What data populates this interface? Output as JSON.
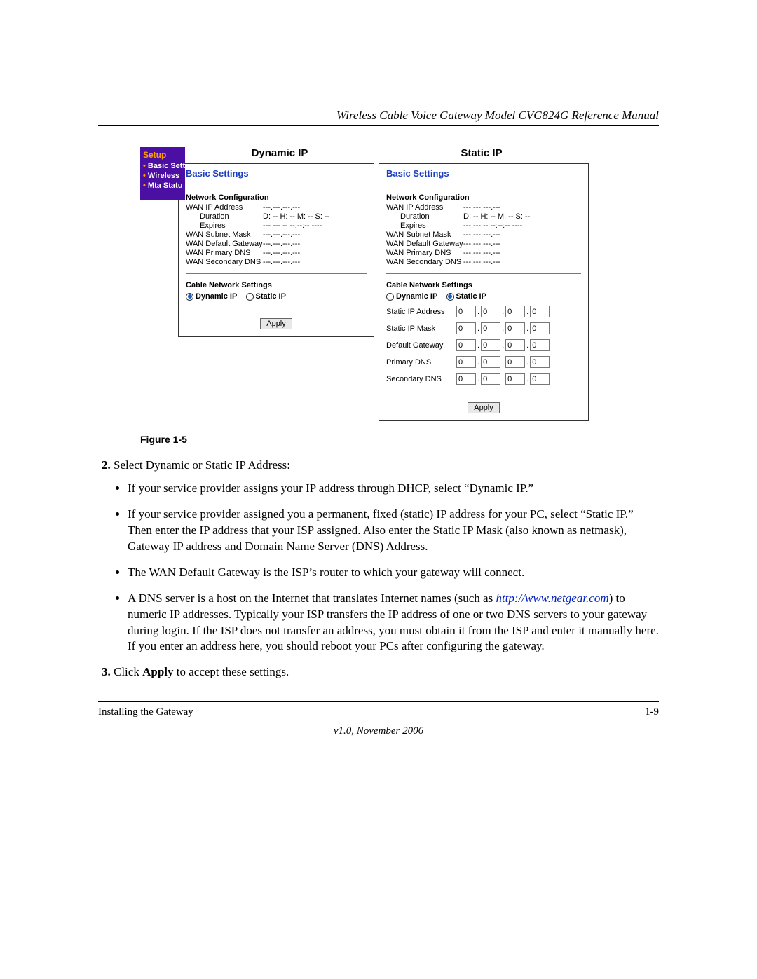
{
  "header": {
    "running": "Wireless Cable Voice Gateway Model CVG824G Reference Manual"
  },
  "figure": {
    "caption": "Figure 1-5",
    "nav": {
      "title": "Setup",
      "items": [
        "Basic Settings",
        "Wireless",
        "Mta Statu"
      ]
    },
    "dynamic": {
      "title": "Dynamic IP",
      "panelTitle": "Basic Settings",
      "section1": "Network Configuration",
      "rows": {
        "wanIp": {
          "k": "WAN IP Address",
          "v": "---.---.---.---"
        },
        "duration": {
          "k": "Duration",
          "v": "D: -- H: -- M: -- S: --"
        },
        "expires": {
          "k": "Expires",
          "v": "--- --- -- --:--:-- ----"
        },
        "subnet": {
          "k": "WAN Subnet Mask",
          "v": "---.---.---.---"
        },
        "gw": {
          "k": "WAN Default Gateway",
          "v": "---.---.---.---"
        },
        "dns1": {
          "k": "WAN Primary DNS",
          "v": "---.---.---.---"
        },
        "dns2": {
          "k": "WAN Secondary DNS",
          "v": "---.---.---.---"
        }
      },
      "section2": "Cable Network Settings",
      "radio1": "Dynamic IP",
      "radio2": "Static IP",
      "apply": "Apply"
    },
    "static": {
      "title": "Static IP",
      "panelTitle": "Basic Settings",
      "section1": "Network Configuration",
      "rows": {
        "wanIp": {
          "k": "WAN IP Address",
          "v": "---.---.---.---"
        },
        "duration": {
          "k": "Duration",
          "v": "D: -- H: -- M: -- S: --"
        },
        "expires": {
          "k": "Expires",
          "v": "--- --- -- --:--:-- ----"
        },
        "subnet": {
          "k": "WAN Subnet Mask",
          "v": "---.---.---.---"
        },
        "gw": {
          "k": "WAN Default Gateway",
          "v": "---.---.---.---"
        },
        "dns1": {
          "k": "WAN Primary DNS",
          "v": "---.---.---.---"
        },
        "dns2": {
          "k": "WAN Secondary DNS",
          "v": "---.---.---.---"
        }
      },
      "section2": "Cable Network Settings",
      "radio1": "Dynamic IP",
      "radio2": "Static IP",
      "ipLabels": {
        "addr": "Static IP Address",
        "mask": "Static IP Mask",
        "gw": "Default Gateway",
        "dns1": "Primary DNS",
        "dns2": "Secondary DNS"
      },
      "octet": "0",
      "apply": "Apply"
    }
  },
  "body": {
    "step2": "Select Dynamic or Static IP Address:",
    "b1": "If your service provider assigns your IP address through DHCP, select “Dynamic IP.”",
    "b2": "If your service provider assigned you a permanent, fixed (static) IP address for your PC, select “Static IP.” Then enter the IP address that your ISP assigned. Also enter the Static IP Mask (also known as netmask), Gateway IP address and Domain Name Server (DNS) Address.",
    "b3": "The WAN Default Gateway is the ISP’s router to which your gateway will connect.",
    "b4a": "A DNS server is a host on the Internet that translates Internet names (such as ",
    "b4link": "http://www.netgear.com",
    "b4b": ") to numeric IP addresses. Typically your ISP transfers the IP address of one or two DNS servers to your gateway during login. If the ISP does not transfer an address, you must obtain it from the ISP and enter it manually here. If you enter an address here, you should reboot your PCs after configuring the gateway.",
    "step3a": "Click ",
    "step3b": "Apply",
    "step3c": " to accept these settings."
  },
  "footer": {
    "left": "Installing the Gateway",
    "right": "1-9",
    "center": "v1.0, November 2006"
  }
}
